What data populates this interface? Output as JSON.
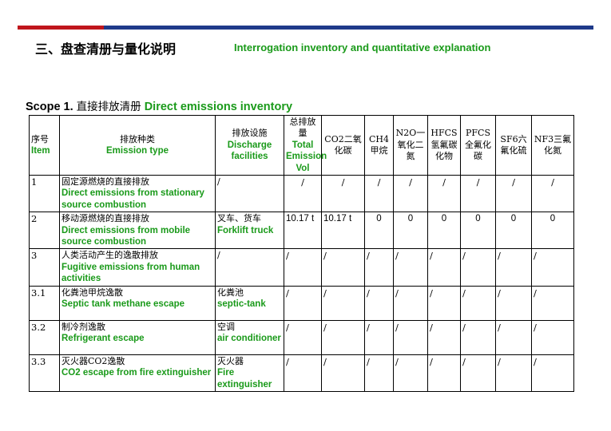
{
  "header": {
    "title_cn": "三、盘查清册与量化说明",
    "title_en": "Interrogation inventory and quantitative explanation"
  },
  "scope": {
    "label": "Scope 1.",
    "label_cn": "直接排放清册",
    "label_en": "Direct emissions inventory"
  },
  "table": {
    "headers": {
      "no": {
        "cn": "序号",
        "en": "Item"
      },
      "type": {
        "cn": "排放种类",
        "en": "Emission type"
      },
      "facility": {
        "cn": "排放设施",
        "en": "Discharge facilities"
      },
      "total": {
        "cn": "总排放量",
        "en": "Total Emission Vol"
      },
      "co2": {
        "cn": "CO2二氧化碳"
      },
      "ch4": {
        "cn": "CH4甲烷"
      },
      "n2o": {
        "cn": "N2O一氧化二氮"
      },
      "hfcs": {
        "cn": "HFCS氢氟碳化物"
      },
      "pfcs": {
        "cn": "PFCS全氟化碳"
      },
      "sf6": {
        "cn": "SF6六氟化硫"
      },
      "nf3": {
        "cn": "NF3三氟化氮"
      }
    },
    "rows": [
      {
        "no": "1",
        "type_cn": "固定源燃烧的直接排放",
        "type_en": "Direct emissions from stationary source combustion",
        "facility_cn": "/",
        "facility_en": "",
        "total": "/",
        "co2": "/",
        "ch4": "/",
        "n2o": "/",
        "hfcs": "/",
        "pfcs": "/",
        "sf6": "/",
        "nf3": "/"
      },
      {
        "no": "2",
        "type_cn": "移动源燃烧的直接排放",
        "type_en": "Direct emissions from mobile source combustion",
        "facility_cn": "叉车、货车",
        "facility_en": "Forklift truck",
        "total": "10.17 t",
        "co2": "10.17 t",
        "ch4": "0",
        "n2o": "0",
        "hfcs": "0",
        "pfcs": "0",
        "sf6": "0",
        "nf3": "0"
      },
      {
        "no": "3",
        "type_cn": "人类活动产生的逸散排放",
        "type_en": "Fugitive emissions from human activities",
        "facility_cn": "/",
        "facility_en": "",
        "total": "/",
        "co2": "/",
        "ch4": "/",
        "n2o": "/",
        "hfcs": "/",
        "pfcs": "/",
        "sf6": "/",
        "nf3": "/"
      },
      {
        "no": "3.1",
        "type_cn": "化粪池甲烷逸散",
        "type_en": "Septic tank methane escape",
        "facility_cn": "化粪池",
        "facility_en": "septic-tank",
        "total": "/",
        "co2": "/",
        "ch4": "/",
        "n2o": "/",
        "hfcs": "/",
        "pfcs": "/",
        "sf6": "/",
        "nf3": "/"
      },
      {
        "no": "3.2",
        "type_cn": "制冷剂逸散",
        "type_en": "Refrigerant escape",
        "facility_cn": "空调",
        "facility_en": "air conditioner",
        "total": "/",
        "co2": "/",
        "ch4": "/",
        "n2o": "/",
        "hfcs": "/",
        "pfcs": "/",
        "sf6": "/",
        "nf3": "/"
      },
      {
        "no": "3.3",
        "type_cn": "灭火器CO2逸散",
        "type_en": "CO2 escape from fire extinguisher",
        "facility_cn": "灭火器",
        "facility_en": "Fire extinguisher",
        "total": "/",
        "co2": "/",
        "ch4": "/",
        "n2o": "/",
        "hfcs": "/",
        "pfcs": "/",
        "sf6": "/",
        "nf3": "/"
      }
    ]
  },
  "colors": {
    "accent_green": "#1a9a1a",
    "bar_red": "#c0161c",
    "bar_blue": "#1f3a8a"
  }
}
